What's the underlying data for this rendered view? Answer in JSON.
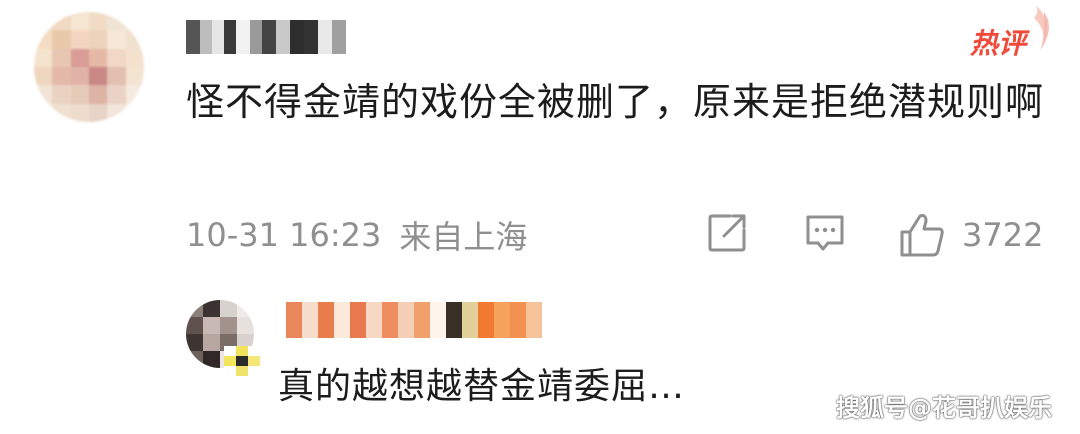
{
  "comment": {
    "text": "怪不得金靖的戏份全被删了，原来是拒绝潜规则啊",
    "timestamp": "10-31 16:23",
    "location": "来自上海",
    "like_count": "3722",
    "hot_label": "热评",
    "hot_color": "#ef4a3a"
  },
  "reply": {
    "text": "真的越想越替金靖委屈…"
  },
  "watermark": "搜狐号@花哥扒娱乐",
  "icons": {
    "share": "share-icon",
    "comment": "comment-icon",
    "like": "thumbs-up-icon"
  }
}
